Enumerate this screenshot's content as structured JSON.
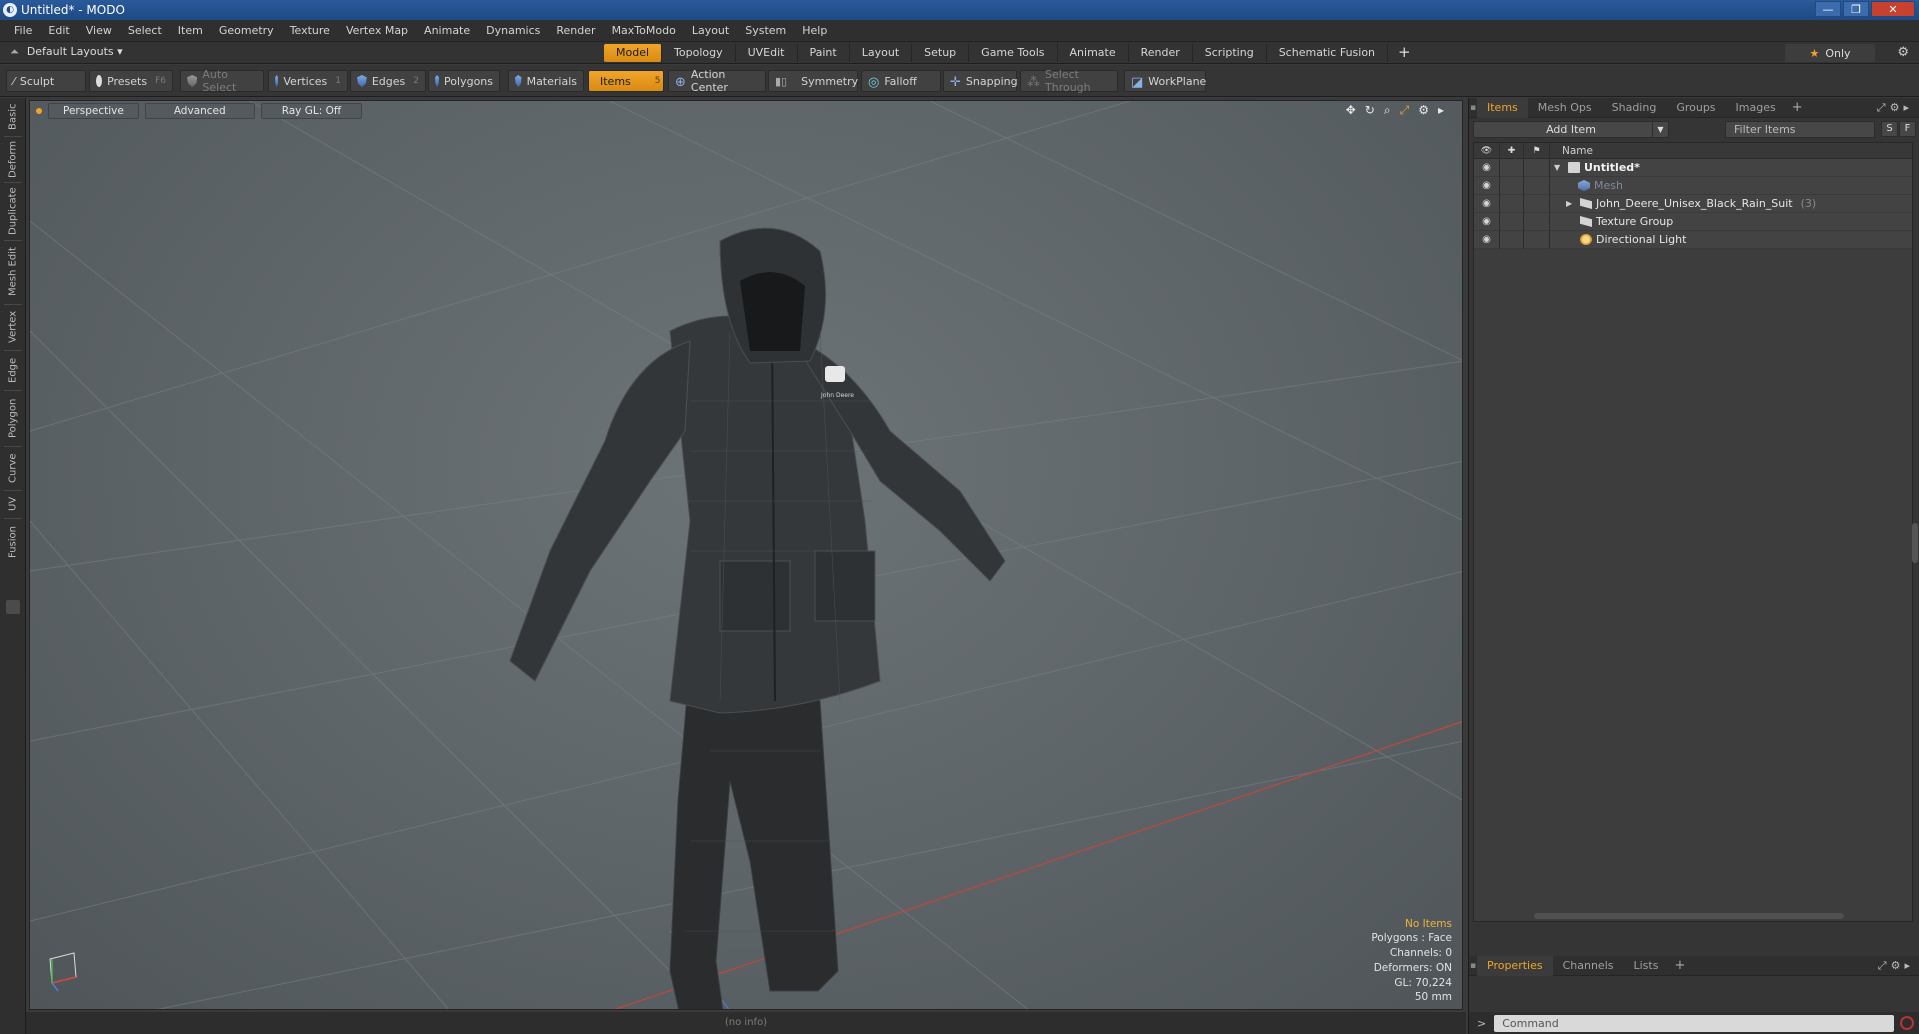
{
  "window": {
    "title": "Untitled* - MODO"
  },
  "menu": [
    "File",
    "Edit",
    "View",
    "Select",
    "Item",
    "Geometry",
    "Texture",
    "Vertex Map",
    "Animate",
    "Dynamics",
    "Render",
    "MaxToModo",
    "Layout",
    "System",
    "Help"
  ],
  "layout_selector": "Default Layouts",
  "layout_tabs": [
    {
      "label": "Model",
      "active": true
    },
    {
      "label": "Topology"
    },
    {
      "label": "UVEdit"
    },
    {
      "label": "Paint"
    },
    {
      "label": "Layout"
    },
    {
      "label": "Setup"
    },
    {
      "label": "Game Tools"
    },
    {
      "label": "Animate"
    },
    {
      "label": "Render"
    },
    {
      "label": "Scripting"
    },
    {
      "label": "Schematic Fusion"
    }
  ],
  "only_button": "Only",
  "toolbar": {
    "sculpt": "Sculpt",
    "presets": "Presets",
    "presets_key": "F6",
    "auto_select": "Auto Select",
    "vertices": "Vertices",
    "vertices_key": "1",
    "edges": "Edges",
    "edges_key": "2",
    "polygons": "Polygons",
    "materials": "Materials",
    "items": "Items",
    "items_key": "5",
    "action_center": "Action Center",
    "symmetry": "Symmetry",
    "falloff": "Falloff",
    "snapping": "Snapping",
    "select_through": "Select Through",
    "workplane": "WorkPlane"
  },
  "left_tabs": [
    "Basic",
    "Deform",
    "Duplicate",
    "Mesh Edit",
    "Vertex",
    "Edge",
    "Polygon",
    "Curve",
    "UV",
    "Fusion"
  ],
  "viewport": {
    "view": "Perspective",
    "mode": "Advanced",
    "raygl": "Ray GL: Off",
    "stats": {
      "selection": "No Items",
      "polygons": "Polygons : Face",
      "channels": "Channels: 0",
      "deformers": "Deformers: ON",
      "gl": "GL: 70,224",
      "scale": "50 mm"
    },
    "model_logo": "John Deere"
  },
  "status_info": "(no info)",
  "right_panel": {
    "tabs": [
      {
        "label": "Items",
        "active": true
      },
      {
        "label": "Mesh Ops"
      },
      {
        "label": "Shading"
      },
      {
        "label": "Groups"
      },
      {
        "label": "Images"
      }
    ],
    "add_item": "Add Item",
    "filter_placeholder": "Filter Items",
    "s_btn": "S",
    "f_btn": "F",
    "column_name": "Name",
    "items": [
      {
        "label": "Untitled*",
        "type": "scene",
        "bold": true
      },
      {
        "label": "Mesh",
        "type": "mesh",
        "dim": true
      },
      {
        "label": "John_Deere_Unisex_Black_Rain_Suit",
        "count": "(3)",
        "type": "group"
      },
      {
        "label": "Texture Group",
        "type": "group"
      },
      {
        "label": "Directional Light",
        "type": "light"
      }
    ],
    "bottom_tabs": [
      {
        "label": "Properties",
        "active": true
      },
      {
        "label": "Channels"
      },
      {
        "label": "Lists"
      }
    ],
    "command_placeholder": "Command"
  }
}
